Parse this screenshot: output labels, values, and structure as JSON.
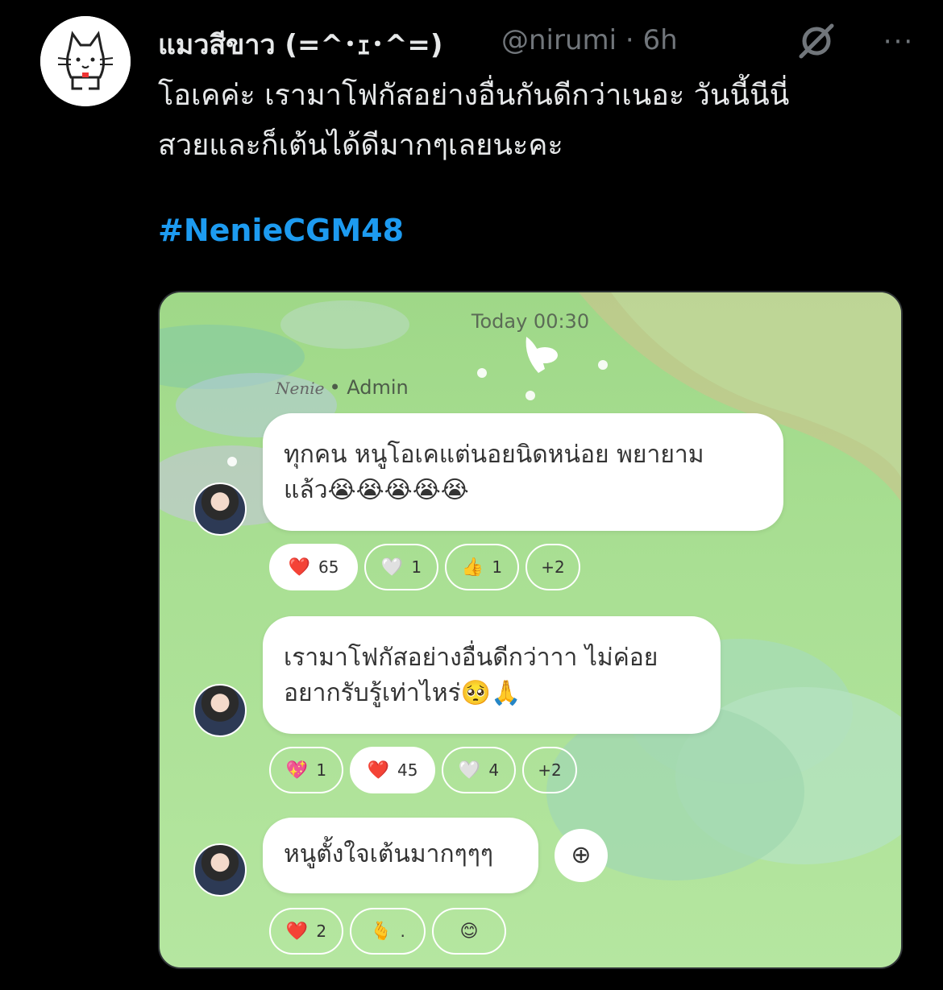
{
  "tweet": {
    "display_name": "แมวสีขาว (=^･ｪ･^=)",
    "handle": "@nirumi",
    "separator": "·",
    "time": "6h",
    "text_line1": "โอเคค่ะ เรามาโฟกัสอย่างอื่นกันดีกว่าเนอะ วันนี้นีนี่",
    "text_line2": "สวยและก็เต้นได้ดีมากๆเลยนะคะ",
    "hashtag": "#NenieCGM48",
    "more_label": "···"
  },
  "chat": {
    "timestamp": "Today 00:30",
    "sender_signature": "Nenie",
    "sender_role": "• Admin",
    "messages": [
      {
        "line1": "ทุกคน หนูโอเคแต่นอยนิดหน่อย พยายาม",
        "line2": "แล้ว😭😭😭😭😭",
        "reactions": [
          {
            "emoji": "❤️",
            "count": "65",
            "filled": true
          },
          {
            "emoji": "🤍",
            "count": "1",
            "filled": false
          },
          {
            "emoji": "👍",
            "count": "1",
            "filled": false
          },
          {
            "emoji": "",
            "count": "+2",
            "filled": false
          }
        ]
      },
      {
        "line1": "เรามาโฟกัสอย่างอื่นดีกว่าาา ไม่ค่อย",
        "line2": "อยากรับรู้เท่าไหร่🥺🙏",
        "reactions": [
          {
            "emoji": "💖",
            "count": "1",
            "filled": false
          },
          {
            "emoji": "❤️",
            "count": "45",
            "filled": true
          },
          {
            "emoji": "🤍",
            "count": "4",
            "filled": false
          },
          {
            "emoji": "",
            "count": "+2",
            "filled": false
          }
        ]
      },
      {
        "line1": "หนูตั้งใจเต้นมากๆๆๆ",
        "line2": "",
        "reactions": [
          {
            "emoji": "❤️",
            "count": "2",
            "filled": false
          },
          {
            "emoji": "🫰",
            "count": ".",
            "filled": false
          },
          {
            "emoji": "😊",
            "count": "",
            "filled": false
          }
        ]
      }
    ],
    "add_reaction_symbol": "⊕"
  },
  "colors": {
    "background": "#000000",
    "text": "#e7e9ea",
    "muted": "#71767b",
    "link": "#1d9bf0",
    "chat_bg": "#a9df93"
  }
}
